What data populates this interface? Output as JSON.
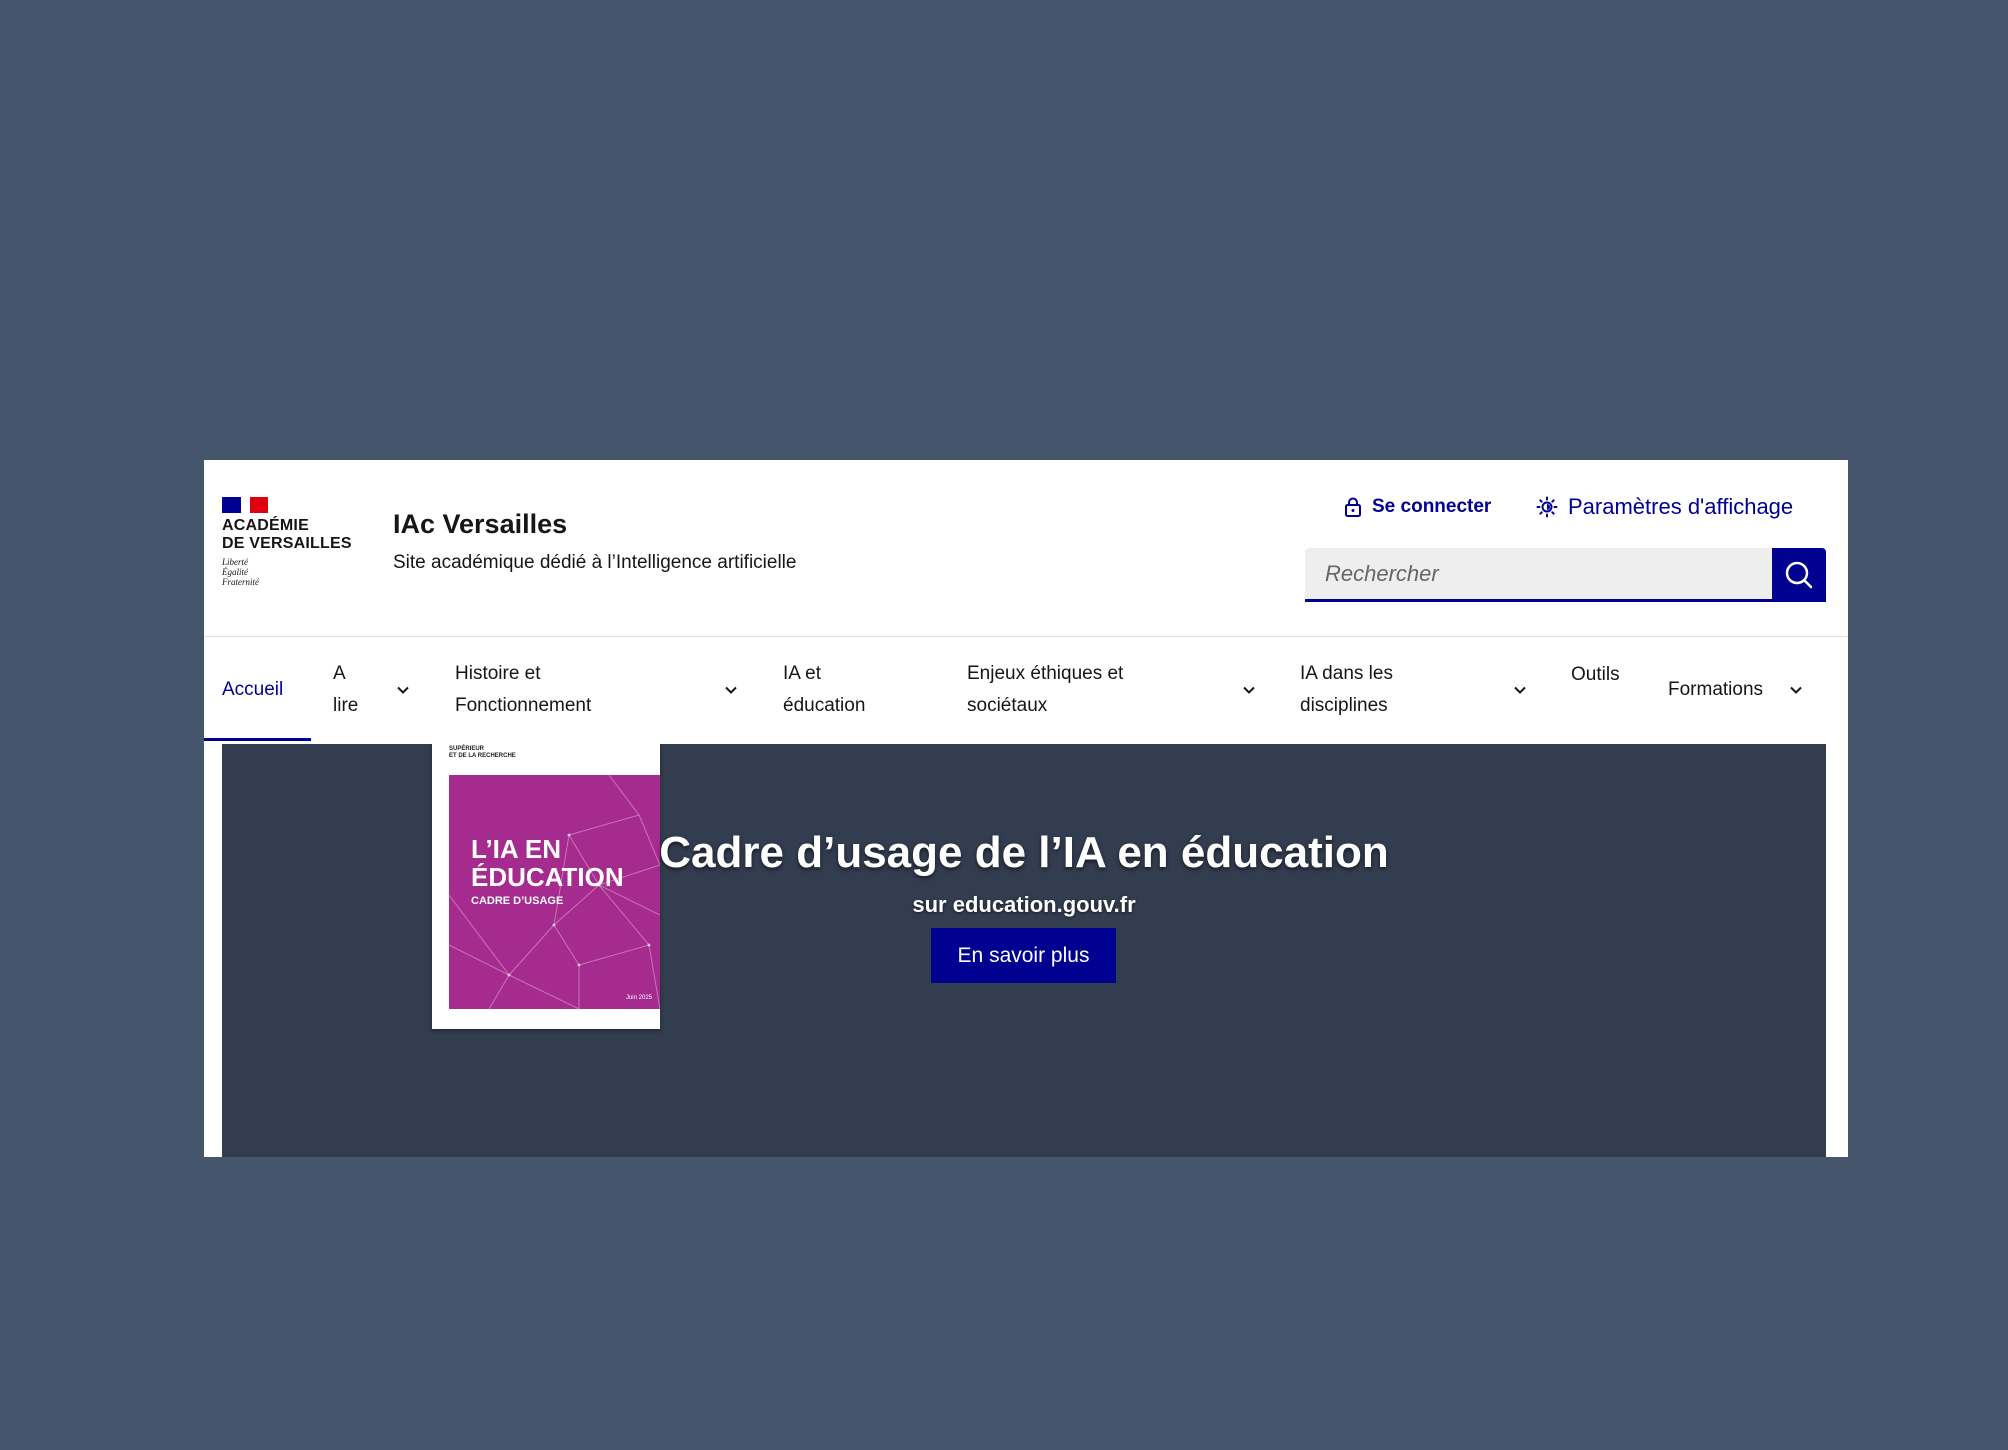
{
  "header": {
    "logo": {
      "name_line1": "ACADÉMIE",
      "name_line2": "DE VERSAILLES",
      "motto_line1": "Liberté",
      "motto_line2": "Égalité",
      "motto_line3": "Fraternité"
    },
    "site_title": "IAc Versailles",
    "site_tagline": "Site académique dédié à l’Intelligence artificielle",
    "login_label": "Se connecter",
    "display_settings_label": "Paramètres d'affichage",
    "search": {
      "placeholder": "Rechercher",
      "value": ""
    }
  },
  "nav": {
    "items": [
      {
        "line1": "Accueil",
        "line2": "",
        "has_dropdown": false,
        "active": true
      },
      {
        "line1": "A",
        "line2": "lire",
        "has_dropdown": true,
        "active": false
      },
      {
        "line1": "Histoire et",
        "line2": "Fonctionnement",
        "has_dropdown": true,
        "active": false
      },
      {
        "line1": "IA et",
        "line2": "éducation",
        "has_dropdown": false,
        "active": false
      },
      {
        "line1": "Enjeux éthiques et",
        "line2": "sociétaux",
        "has_dropdown": true,
        "active": false
      },
      {
        "line1": "IA dans les",
        "line2": "disciplines",
        "has_dropdown": true,
        "active": false
      },
      {
        "line1": "Outils",
        "line2": "",
        "has_dropdown": false,
        "active": false
      },
      {
        "line1": "Formations",
        "line2": "",
        "has_dropdown": true,
        "active": false
      }
    ]
  },
  "hero": {
    "cover": {
      "title_line1": "L’IA EN",
      "title_line2": "ÉDUCATION",
      "subtitle": "CADRE D’USAGE",
      "date": "Juin 2025"
    },
    "title": "Cadre d’usage de l’IA en éducation",
    "subtitle": "sur education.gouv.fr",
    "button_label": "En savoir plus"
  },
  "colors": {
    "brand_blue": "#000091",
    "flag_red": "#e1000f",
    "hero_bg": "#333d50",
    "cover_magenta": "#a62b8e",
    "page_bg": "#45556c"
  }
}
